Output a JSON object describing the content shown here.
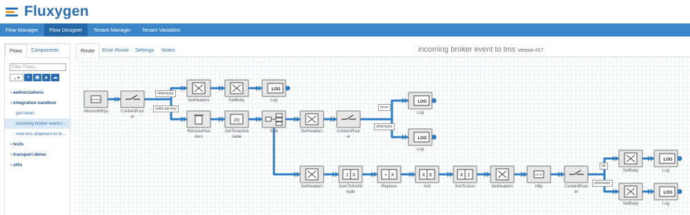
{
  "app": {
    "brand": "Fluxygen"
  },
  "nav": [
    "Flow Manager",
    "Flow Designer",
    "Tenant Manager",
    "Tenant Variables"
  ],
  "sidebar": {
    "tabs": [
      "Flows",
      "Components"
    ],
    "filter_placeholder": "Filter Flows...",
    "tree": [
      {
        "label": "authorizations",
        "type": "folder"
      },
      {
        "label": "integration-sandbox",
        "type": "folder"
      },
      {
        "label": "get token",
        "type": "leaf"
      },
      {
        "label": "incoming broker event t...",
        "type": "leaf",
        "selected": true
      },
      {
        "label": "new tms shipment to br...",
        "type": "leaf"
      },
      {
        "label": "tests",
        "type": "folder"
      },
      {
        "label": "transport demo",
        "type": "folder"
      },
      {
        "label": "utils",
        "type": "folder"
      }
    ]
  },
  "main": {
    "tabs": [
      "Route",
      "Error Route",
      "Settings",
      "Notes"
    ],
    "title": "incoming broker event to tms",
    "version": "Version #17"
  },
  "flow": {
    "nodes": [
      {
        "id": "n1",
        "label": "InboundHttps",
        "icon": "https-icon"
      },
      {
        "id": "n2",
        "label": "ContentRouter",
        "icon": "router-icon"
      },
      {
        "id": "n3",
        "label": "SetHeaders",
        "icon": "setheaders-icon"
      },
      {
        "id": "n4",
        "label": "SetBody",
        "icon": "setbody-icon"
      },
      {
        "id": "n5",
        "label": "Log",
        "icon": "log-icon"
      },
      {
        "id": "n6",
        "label": "RemoveHeaders",
        "icon": "trash-icon"
      },
      {
        "id": "n7",
        "label": "GetTenantVariable",
        "icon": "variable-icon"
      },
      {
        "id": "n8",
        "label": "Split",
        "icon": "split-icon"
      },
      {
        "id": "n9",
        "label": "SetHeaders",
        "icon": "setheaders-icon"
      },
      {
        "id": "n10",
        "label": "ContentRouter",
        "icon": "router-icon"
      },
      {
        "id": "n11",
        "label": "Log",
        "icon": "log-icon"
      },
      {
        "id": "n12",
        "label": "Log",
        "icon": "log-icon"
      },
      {
        "id": "n13",
        "label": "SetHeaders",
        "icon": "setheaders-icon"
      },
      {
        "id": "n14",
        "label": "JsonToXmlSimple",
        "icon": "convert-icon"
      },
      {
        "id": "n15",
        "label": "Replace",
        "icon": "replace-icon"
      },
      {
        "id": "n16",
        "label": "Xslt",
        "icon": "xslt-icon"
      },
      {
        "id": "n17",
        "label": "XmlToJson",
        "icon": "convert-icon"
      },
      {
        "id": "n18",
        "label": "SetHeaders",
        "icon": "setheaders-icon"
      },
      {
        "id": "n19",
        "label": "Http",
        "icon": "http-icon"
      },
      {
        "id": "n20",
        "label": "ContentRouter",
        "icon": "router-icon"
      },
      {
        "id": "n21",
        "label": "SetBody",
        "icon": "setbody-icon"
      },
      {
        "id": "n22",
        "label": "Log",
        "icon": "log-icon"
      },
      {
        "id": "n23",
        "label": "SetBody",
        "icon": "setbody-icon"
      },
      {
        "id": "n24",
        "label": "Log",
        "icon": "log-icon"
      }
    ],
    "branches": [
      "otherwise",
      "valid-api-key",
      "error",
      "otherwise",
      "ok",
      "otherwise"
    ],
    "icon_texts": {
      "https": "HTTPS",
      "http": "HTTP",
      "log": "LOG",
      "variable": "{X}",
      "json": "J",
      "xml": "X",
      "plus": "+"
    },
    "colors": {
      "accent": "#2a7bc4",
      "node_fill": "#e7e7e7",
      "node_border": "#777"
    }
  }
}
